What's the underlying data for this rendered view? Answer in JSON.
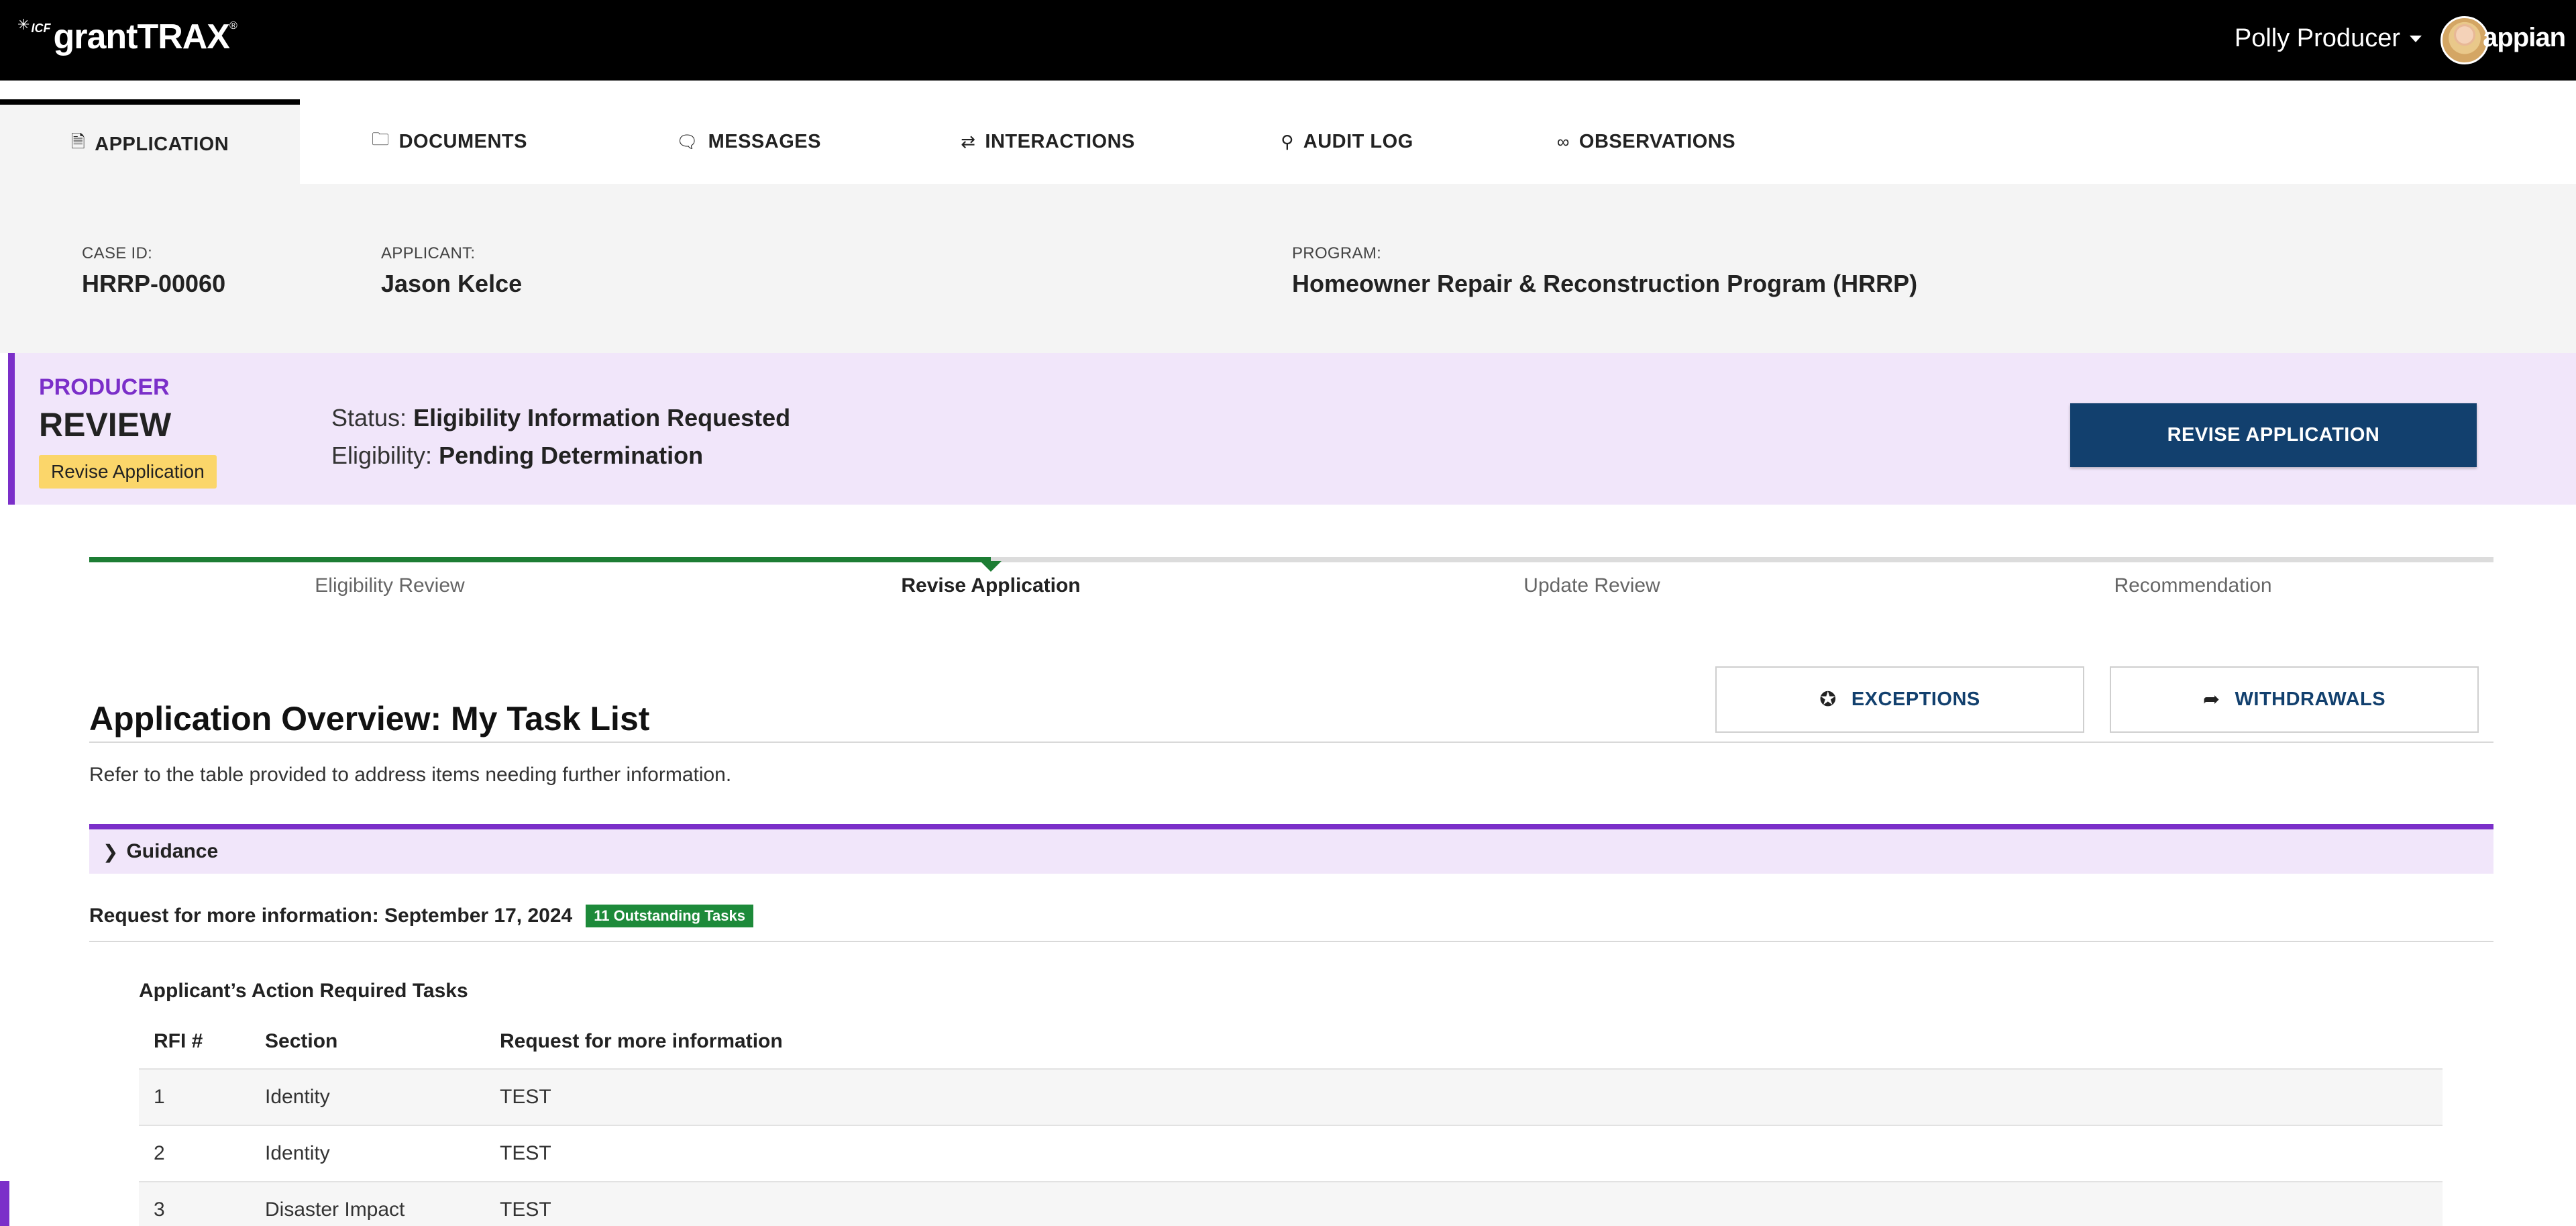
{
  "app": {
    "brand_prefix": "ICF",
    "brand": "grantTRAX",
    "vendor": "appian",
    "user_name": "Polly Producer"
  },
  "tabs": [
    {
      "label": "APPLICATION",
      "icon": "document-icon",
      "active": true
    },
    {
      "label": "DOCUMENTS",
      "icon": "folder-icon",
      "active": false
    },
    {
      "label": "MESSAGES",
      "icon": "message-icon",
      "active": false
    },
    {
      "label": "INTERACTIONS",
      "icon": "exchange-icon",
      "active": false
    },
    {
      "label": "AUDIT LOG",
      "icon": "search-icon",
      "active": false
    },
    {
      "label": "OBSERVATIONS",
      "icon": "glasses-icon",
      "active": false
    }
  ],
  "case": {
    "case_id_label": "CASE ID:",
    "case_id": "HRRP-00060",
    "applicant_label": "APPLICANT:",
    "applicant": "Jason Kelce",
    "program_label": "PROGRAM:",
    "program": "Homeowner Repair & Reconstruction Program (HRRP)"
  },
  "banner": {
    "role": "PRODUCER",
    "stage": "REVIEW",
    "badge": "Revise Application",
    "status_label": "Status:",
    "status": "Eligibility Information Requested",
    "eligibility_label": "Eligibility:",
    "eligibility": "Pending Determination",
    "action_button": "REVISE APPLICATION",
    "accent_color": "#7b2fc9",
    "button_color": "#12406e"
  },
  "stepper": {
    "steps": [
      "Eligibility Review",
      "Revise Application",
      "Update Review",
      "Recommendation"
    ],
    "current_index": 1,
    "complete_color": "#1d7d34"
  },
  "overview": {
    "title": "Application Overview: My Task List",
    "subtitle": "Refer to the table provided to address items needing further information.",
    "exceptions_label": "EXCEPTIONS",
    "withdrawals_label": "WITHDRAWALS",
    "guidance_label": "Guidance",
    "rfi_label": "Request for more information: September 17, 2024",
    "outstanding_badge": "11 Outstanding Tasks",
    "tasks_caption": "Applicant’s Action Required Tasks",
    "table": {
      "headers": [
        "RFI #",
        "Section",
        "Request for more information"
      ],
      "rows": [
        [
          "1",
          "Identity",
          "TEST"
        ],
        [
          "2",
          "Identity",
          "TEST"
        ],
        [
          "3",
          "Disaster Impact",
          "TEST"
        ]
      ]
    }
  }
}
